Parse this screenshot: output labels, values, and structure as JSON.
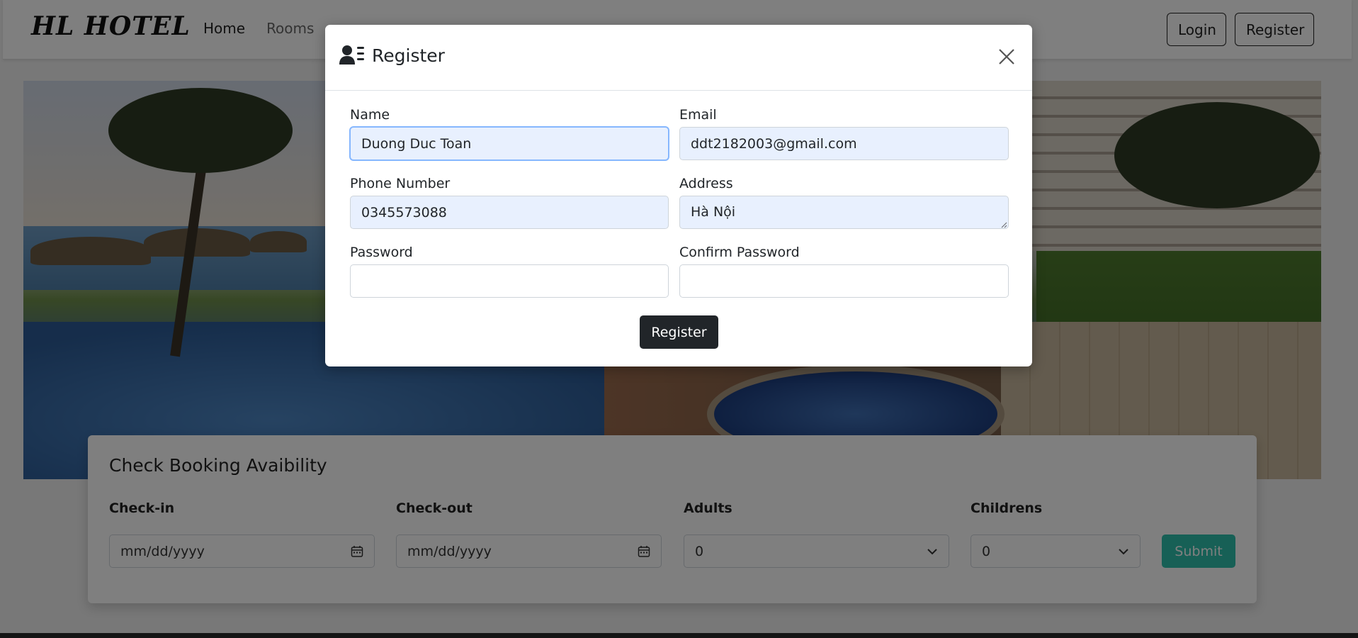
{
  "navbar": {
    "brand": "HL HOTEL",
    "links": [
      "Home",
      "Rooms"
    ],
    "login_label": "Login",
    "register_label": "Register"
  },
  "booking": {
    "title": "Check Booking Avaibility",
    "checkin_label": "Check-in",
    "checkout_label": "Check-out",
    "adults_label": "Adults",
    "children_label": "Childrens",
    "checkin_placeholder": "mm/dd/yyyy",
    "checkout_placeholder": "mm/dd/yyyy",
    "adults_value": "0",
    "children_value": "0",
    "submit_label": "Submit"
  },
  "modal": {
    "title": "Register",
    "fields": {
      "name_label": "Name",
      "name_value": "Duong Duc Toan",
      "email_label": "Email",
      "email_value": "ddt2182003@gmail.com",
      "phone_label": "Phone Number",
      "phone_value": "0345573088",
      "address_label": "Address",
      "address_value": "Hà Nội",
      "password_label": "Password",
      "password_value": "",
      "confirm_label": "Confirm Password",
      "confirm_value": ""
    },
    "submit_label": "Register"
  },
  "colors": {
    "accent_teal": "#2ec1ac",
    "dark_button": "#212529",
    "autofill_bg": "#e8f0fe"
  }
}
